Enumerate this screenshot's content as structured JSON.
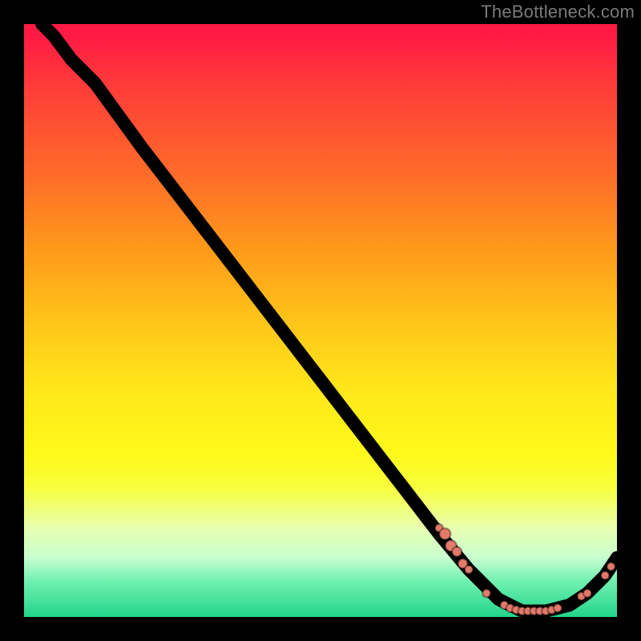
{
  "watermark": "TheBottleneck.com",
  "colors": {
    "background": "#000000",
    "point": "#e27a6a",
    "line": "#000000"
  },
  "chart_data": {
    "type": "line",
    "title": "",
    "xlabel": "",
    "ylabel": "",
    "xlim": [
      0,
      100
    ],
    "ylim": [
      0,
      100
    ],
    "curve": [
      {
        "x": 3,
        "y": 100
      },
      {
        "x": 5,
        "y": 98
      },
      {
        "x": 8,
        "y": 94
      },
      {
        "x": 12,
        "y": 90
      },
      {
        "x": 20,
        "y": 79
      },
      {
        "x": 30,
        "y": 66
      },
      {
        "x": 40,
        "y": 53
      },
      {
        "x": 50,
        "y": 40
      },
      {
        "x": 60,
        "y": 27
      },
      {
        "x": 70,
        "y": 14
      },
      {
        "x": 75,
        "y": 8
      },
      {
        "x": 80,
        "y": 3
      },
      {
        "x": 84,
        "y": 1
      },
      {
        "x": 88,
        "y": 1
      },
      {
        "x": 92,
        "y": 2
      },
      {
        "x": 95,
        "y": 4
      },
      {
        "x": 98,
        "y": 7
      },
      {
        "x": 100,
        "y": 10
      }
    ],
    "points": [
      {
        "x": 70,
        "y": 15,
        "r": 5
      },
      {
        "x": 71,
        "y": 14,
        "r": 7
      },
      {
        "x": 72,
        "y": 12,
        "r": 7
      },
      {
        "x": 73,
        "y": 11,
        "r": 6
      },
      {
        "x": 74,
        "y": 9,
        "r": 6
      },
      {
        "x": 75,
        "y": 8,
        "r": 5
      },
      {
        "x": 78,
        "y": 4,
        "r": 5
      },
      {
        "x": 81,
        "y": 2,
        "r": 5
      },
      {
        "x": 82,
        "y": 1.5,
        "r": 5
      },
      {
        "x": 83,
        "y": 1.2,
        "r": 5
      },
      {
        "x": 84,
        "y": 1,
        "r": 5
      },
      {
        "x": 85,
        "y": 1,
        "r": 5
      },
      {
        "x": 86,
        "y": 1,
        "r": 5
      },
      {
        "x": 87,
        "y": 1,
        "r": 5
      },
      {
        "x": 88,
        "y": 1,
        "r": 5
      },
      {
        "x": 89,
        "y": 1.2,
        "r": 5
      },
      {
        "x": 90,
        "y": 1.5,
        "r": 5
      },
      {
        "x": 94,
        "y": 3.5,
        "r": 5
      },
      {
        "x": 95,
        "y": 4,
        "r": 5
      },
      {
        "x": 98,
        "y": 7,
        "r": 5
      },
      {
        "x": 99,
        "y": 8.5,
        "r": 5
      }
    ]
  }
}
